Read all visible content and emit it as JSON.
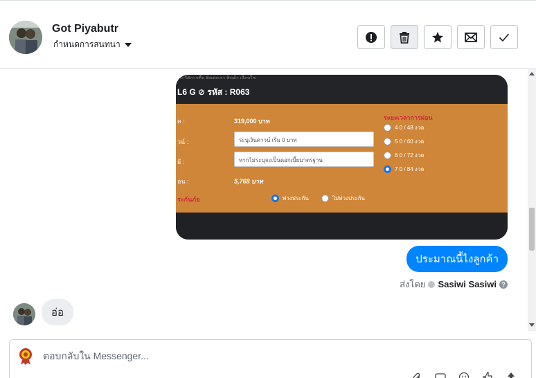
{
  "header": {
    "contact_name": "Got Piyabutr",
    "assign_label": "กำหนดการสนทนา",
    "actions": [
      {
        "name": "report-spam-icon"
      },
      {
        "name": "trash-icon"
      },
      {
        "name": "star-icon"
      },
      {
        "name": "envelope-icon"
      },
      {
        "name": "checkmark-icon"
      }
    ]
  },
  "attachment": {
    "nav_text": "ประวัติการซื้อ  ติดต่อเรา  สินค้า  เงื่อนไข",
    "title": "L6 G ⊘ รหัส : R063",
    "rows": [
      {
        "label": "ด :",
        "value": "319,000 บาท"
      },
      {
        "label": "วน์ :",
        "input": "ระบุเงินดาวน์ เริ่ม 0 บาท"
      },
      {
        "label": "ย้ :",
        "input": "หากไม่ระบุจะเป็นดอกเบี้ยมาตรฐาน"
      },
      {
        "label": "อน :",
        "value": "5,768 บาท"
      }
    ],
    "insurance_label": "ระกันภัย",
    "insurance_options": [
      "พ่วงประกัน",
      "ไม่พ่วงประกัน"
    ],
    "period_title": "ระยะเวลาการผ่อน",
    "period_options": [
      "4 0 / 48 งวด",
      "5 0 / 60 งวด",
      "6 0 / 72 งวด",
      "7 0 / 84 งวด"
    ]
  },
  "messages": {
    "outgoing_text": "ประมาณนี้ไงลูกค้า",
    "sent_by_label": "ส่งโดย",
    "sender_name": "Sasiwi Sasiwi",
    "incoming_text": "อ่อ"
  },
  "composer": {
    "placeholder": "ตอบกลับใน Messenger..."
  },
  "colors": {
    "accent": "#0084ff",
    "form_bg": "#cf8638",
    "dark_bg": "#1f2124"
  }
}
